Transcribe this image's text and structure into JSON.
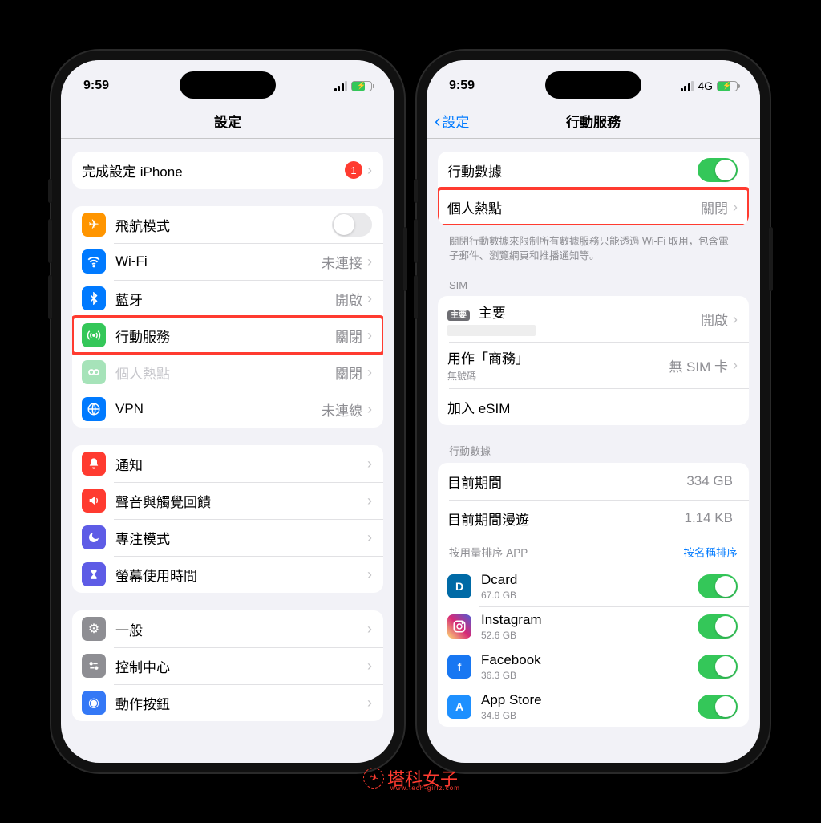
{
  "status_time": "9:59",
  "network_label": "4G",
  "left": {
    "nav_title": "設定",
    "setup": {
      "label": "完成設定 iPhone",
      "badge": "1"
    },
    "conn": {
      "airplane": "飛航模式",
      "wifi": "Wi-Fi",
      "wifi_val": "未連接",
      "bt": "藍牙",
      "bt_val": "開啟",
      "cellular": "行動服務",
      "cellular_val": "關閉",
      "hotspot": "個人熱點",
      "hotspot_val": "關閉",
      "vpn": "VPN",
      "vpn_val": "未連線"
    },
    "notif": {
      "notifications": "通知",
      "sounds": "聲音與觸覺回饋",
      "focus": "專注模式",
      "screentime": "螢幕使用時間"
    },
    "gen": {
      "general": "一般",
      "control": "控制中心",
      "action": "動作按鈕"
    }
  },
  "right": {
    "back": "設定",
    "nav_title": "行動服務",
    "cellular_data": "行動數據",
    "hotspot": "個人熱點",
    "hotspot_val": "關閉",
    "footer": "關閉行動數據來限制所有數據服務只能透過 Wi-Fi 取用，包含電子郵件、瀏覽網頁和推播通知等。",
    "sim_header": "SIM",
    "sim_primary_badge": "主要",
    "sim_primary": "主要",
    "sim_primary_val": "開啟",
    "sim_biz": "用作「商務」",
    "sim_biz_sub": "無號碼",
    "sim_biz_val": "無 SIM 卡",
    "add_esim": "加入 eSIM",
    "data_header": "行動數據",
    "period": "目前期間",
    "period_val": "334 GB",
    "roaming": "目前期間漫遊",
    "roaming_val": "1.14 KB",
    "sort_by_usage": "按用量排序 APP",
    "sort_by_name": "按名稱排序",
    "apps": [
      {
        "name": "Dcard",
        "usage": "67.0 GB"
      },
      {
        "name": "Instagram",
        "usage": "52.6 GB"
      },
      {
        "name": "Facebook",
        "usage": "36.3 GB"
      },
      {
        "name": "App Store",
        "usage": "34.8 GB"
      }
    ]
  },
  "watermark": {
    "text": "塔科女子",
    "url": "www.tech-girlz.com"
  }
}
